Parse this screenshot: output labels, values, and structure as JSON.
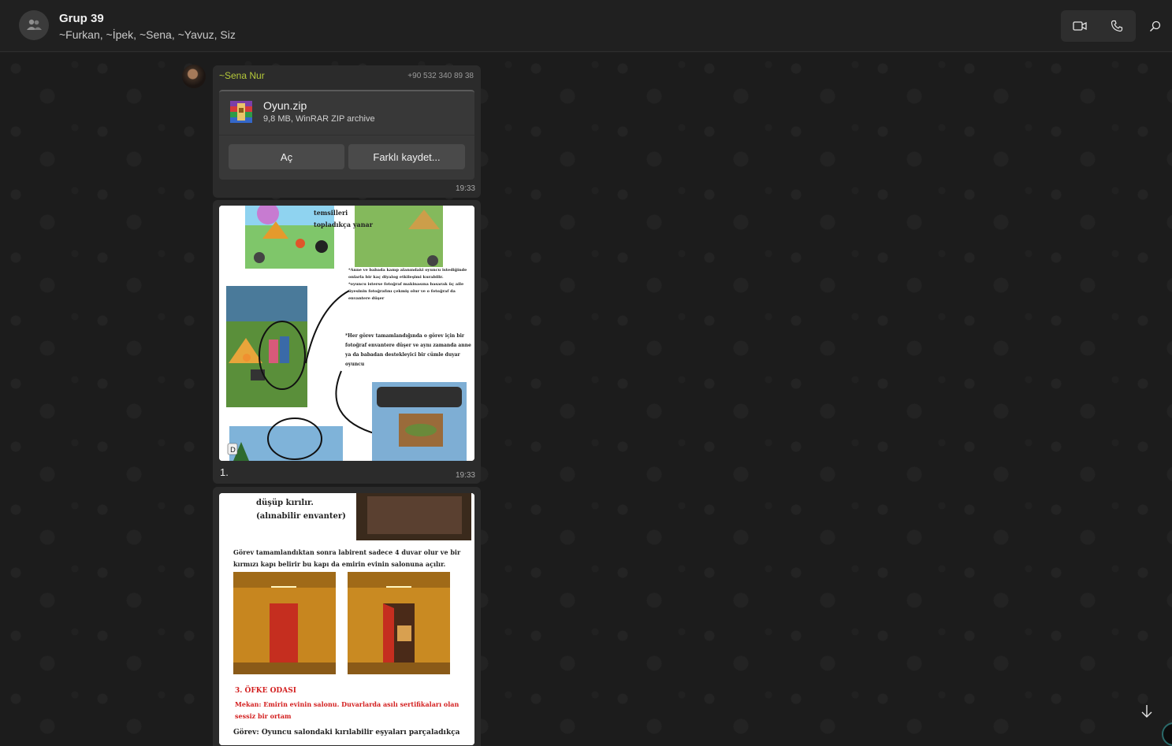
{
  "header": {
    "title": "Grup 39",
    "members": "~Furkan, ~İpek, ~Sena, ~Yavuz, Siz",
    "icons": [
      "group-avatar-icon",
      "video-call-icon",
      "voice-call-icon",
      "search-icon"
    ]
  },
  "messages": [
    {
      "sender": "~Sena Nur",
      "phone": "+90 532 340 89 38",
      "file": {
        "name": "Oyun.zip",
        "meta": "9,8 MB, WinRAR ZIP archive",
        "open_label": "Aç",
        "save_label": "Farklı kaydet..."
      },
      "time": "19:33"
    },
    {
      "image_text": {
        "top_line1": "temsilleri",
        "top_line2": "topladıkça yanar",
        "note1": "*Anne ve babada kamp alanındaki oyuncu istediğinde onlarla bir kaç diyalog etkileşimi kurabilir.",
        "note2": "*oyuncu isterse fotoğraf makinasına basarak üç aile üyesinin fotoğrafını çekmiş olur ve o fotoğraf da envantere düşer",
        "note3": "*Her görev tamamlandığında o görev için bir fotoğraf envantere düşer ve aynı zamanda anne ya da babadan destekleyici bir cümle duyar oyuncu",
        "d_label": "D"
      },
      "caption": "1.",
      "time": "19:33"
    },
    {
      "image_text": {
        "line1": "düşüp kırılır.",
        "line2": "(alınabilir envanter)",
        "para1": "Görev tamamlandıktan sonra labirent sadece 4 duvar olur ve bir kırmızı kapı belirir bu kapı da emirin evinin salonuna açılır.",
        "heading": "3. ÖFKE ODASI",
        "red_desc": "Mekan: Emirin evinin salonu. Duvarlarda asılı sertifikaları olan sessiz bir ortam",
        "task": "Görev: Oyuncu salondaki kırılabilir eşyaları parçaladıkça"
      }
    }
  ],
  "colors": {
    "sender_name": "#b5c93a",
    "background": "#1c1c1c",
    "bubble": "#2b2b2b"
  }
}
